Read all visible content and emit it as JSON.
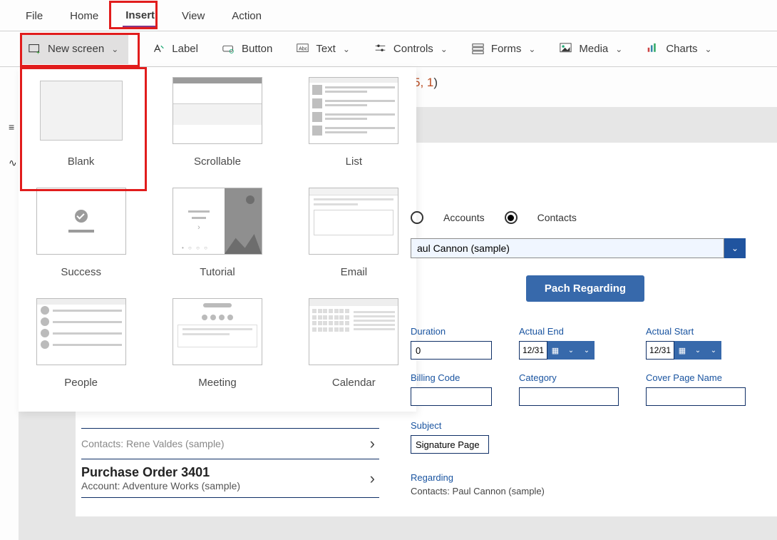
{
  "menu": {
    "file": "File",
    "home": "Home",
    "insert": "Insert",
    "view": "View",
    "action": "Action"
  },
  "ribbon": {
    "new_screen": "New screen",
    "label": "Label",
    "button": "Button",
    "text": "Text",
    "controls": "Controls",
    "forms": "Forms",
    "media": "Media",
    "charts": "Charts"
  },
  "formula_fragment_num": "5, 1",
  "gallery": {
    "blank": "Blank",
    "scrollable": "Scrollable",
    "list": "List",
    "success": "Success",
    "tutorial": "Tutorial",
    "email": "Email",
    "people": "People",
    "meeting": "Meeting",
    "calendar": "Calendar"
  },
  "form": {
    "radio_accounts": "Accounts",
    "radio_contacts": "Contacts",
    "combo_value": "aul Cannon (sample)",
    "btn_label": "Pach Regarding",
    "duration_lbl": "Duration",
    "duration_val": "0",
    "actual_end_lbl": "Actual End",
    "actual_start_lbl": "Actual Start",
    "date_frag": "12/31",
    "billing_lbl": "Billing Code",
    "category_lbl": "Category",
    "cover_lbl": "Cover Page Name",
    "subject_lbl": "Subject",
    "subject_val": "Signature Page",
    "regarding_lbl": "Regarding",
    "regarding_val": "Contacts: Paul Cannon (sample)"
  },
  "list_peek": {
    "row1_title": "Contacts: Rene Valdes (sample)",
    "row2_title": "Purchase Order 3401",
    "row2_sub": "Account: Adventure Works (sample)"
  },
  "colors": {
    "accent": "#833686",
    "red": "#e11c1c",
    "blue": "#3769ab",
    "dkblue": "#0f2f66"
  }
}
